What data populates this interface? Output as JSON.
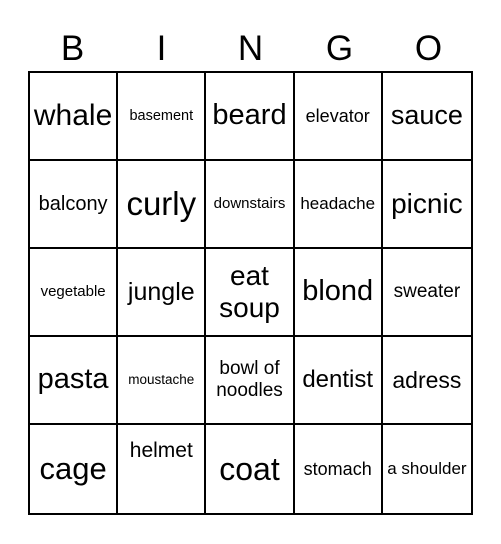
{
  "header": [
    "B",
    "I",
    "N",
    "G",
    "O"
  ],
  "cells": [
    {
      "text": "whale",
      "size": 30
    },
    {
      "text": "basement",
      "size": 14.5
    },
    {
      "text": "beard",
      "size": 29
    },
    {
      "text": "elevator",
      "size": 18
    },
    {
      "text": "sauce",
      "size": 27
    },
    {
      "text": "balcony",
      "size": 20
    },
    {
      "text": "curly",
      "size": 33
    },
    {
      "text": "downstairs",
      "size": 15
    },
    {
      "text": "headache",
      "size": 17
    },
    {
      "text": "picnic",
      "size": 28
    },
    {
      "text": "vegetable",
      "size": 15
    },
    {
      "text": "jungle",
      "size": 25
    },
    {
      "text": "eat soup",
      "size": 28
    },
    {
      "text": "blond",
      "size": 29
    },
    {
      "text": "sweater",
      "size": 19
    },
    {
      "text": "pasta",
      "size": 29
    },
    {
      "text": "moustache",
      "size": 13.5
    },
    {
      "text": "bowl of noodles",
      "size": 19
    },
    {
      "text": "dentist",
      "size": 24
    },
    {
      "text": "adress",
      "size": 23
    },
    {
      "text": "cage",
      "size": 31
    },
    {
      "text": "helmet",
      "size": 21,
      "align": "top"
    },
    {
      "text": "coat",
      "size": 32
    },
    {
      "text": "stomach",
      "size": 18
    },
    {
      "text": "a shoulder",
      "size": 17
    }
  ]
}
